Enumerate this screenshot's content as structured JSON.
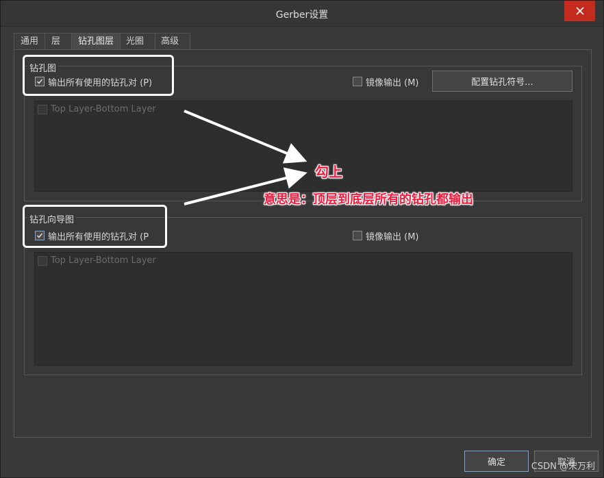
{
  "window": {
    "title": "Gerber设置"
  },
  "tabs": [
    {
      "label": "通用"
    },
    {
      "label": "层"
    },
    {
      "label": "钻孔图层"
    },
    {
      "label": "光圈"
    },
    {
      "label": "高级"
    }
  ],
  "active_tab": "钻孔图层",
  "drill_drawing": {
    "group_title": "钻孔图",
    "plot_used_pairs": {
      "label": "输出所有使用的钻孔对 (P)",
      "checked": true
    },
    "mirror_output": {
      "label": "镜像输出 (M)",
      "checked": false
    },
    "config_button": "配置钻孔符号...",
    "layer_pairs": [
      {
        "label": "Top Layer-Bottom Layer",
        "checked": false
      }
    ]
  },
  "drill_guide": {
    "group_title": "钻孔向导图",
    "plot_used_pairs": {
      "label": "输出所有使用的钻孔对 (P",
      "checked": true
    },
    "mirror_output": {
      "label": "镜像输出 (M)",
      "checked": false
    },
    "layer_pairs": [
      {
        "label": "Top Layer-Bottom Layer",
        "checked": false
      }
    ]
  },
  "footer": {
    "ok_label": "确定",
    "cancel_label": "取消"
  },
  "annotations": {
    "check_note": "勾上",
    "meaning_note": "意思是：顶层到底层所有的钻孔都输出",
    "color": "#f01a3c"
  },
  "watermark": "CSDN @宋万利"
}
